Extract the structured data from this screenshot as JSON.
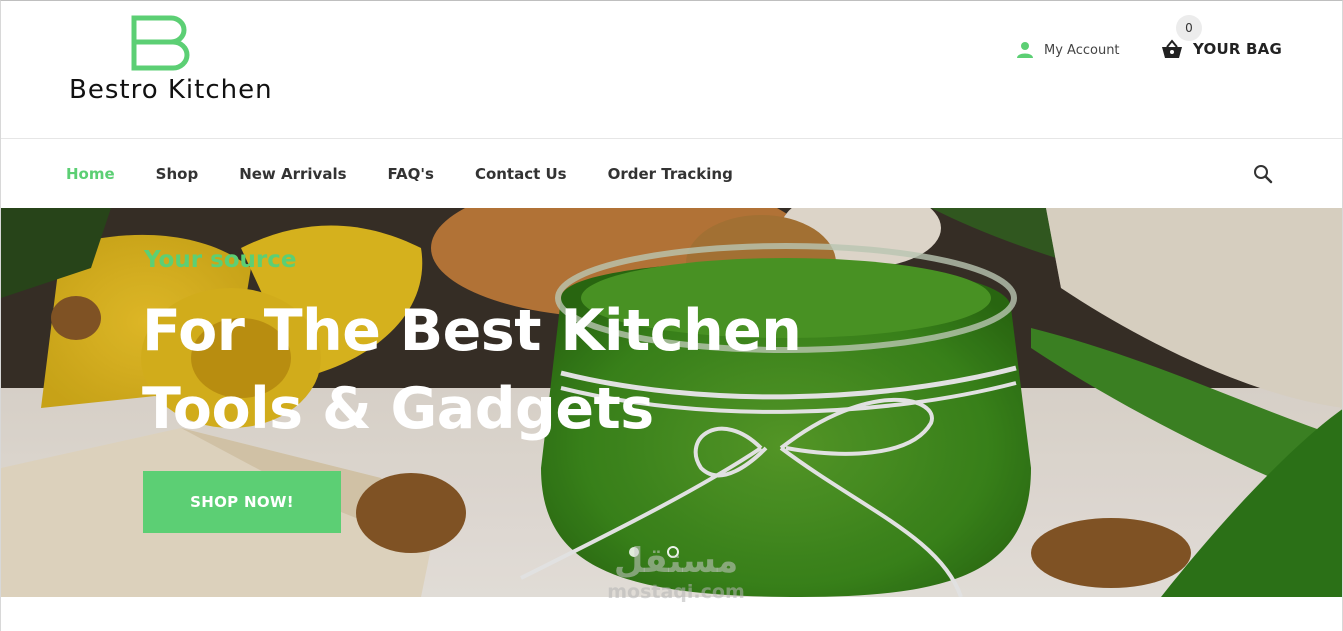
{
  "brand": {
    "logo_text": "Bestro Kitchen",
    "accent_color": "#5ccf74"
  },
  "header": {
    "account_label": "My Account",
    "account_icon": "user-icon",
    "bag_label": "YOUR BAG",
    "bag_icon": "basket-icon",
    "bag_count": "0"
  },
  "nav": {
    "items": [
      {
        "label": "Home",
        "active": true
      },
      {
        "label": "Shop",
        "active": false
      },
      {
        "label": "New Arrivals",
        "active": false
      },
      {
        "label": "FAQ's",
        "active": false
      },
      {
        "label": "Contact Us",
        "active": false
      },
      {
        "label": "Order Tracking",
        "active": false
      }
    ],
    "search_icon": "search-icon"
  },
  "hero": {
    "kicker": "Your source",
    "title_line1": "For The Best Kitchen",
    "title_line2": "Tools & Gadgets",
    "cta_label": "SHOP NOW!",
    "slides": 2,
    "active_slide": 2
  },
  "watermark": {
    "arabic": "مستقل",
    "latin": "mostaqi.com"
  }
}
